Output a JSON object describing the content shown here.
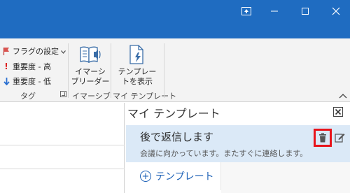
{
  "ribbon": {
    "tags_group": {
      "items": [
        {
          "label": "フラグの設定",
          "icon": "flag-icon"
        },
        {
          "label": "重要度 - 高",
          "icon": "exclamation-icon"
        },
        {
          "label": "重要度 - 低",
          "icon": "down-arrow-icon"
        }
      ],
      "group_label": "タグ"
    },
    "immersive_group": {
      "button_line1": "イマーシ",
      "button_line2": "ブリーダー",
      "group_label": "イマーシブ"
    },
    "templates_group": {
      "button_line1": "テンプレー",
      "button_line2": "トを表示",
      "group_label": "マイ テンプレート"
    }
  },
  "templates_pane": {
    "title": "マイ テンプレート",
    "items": [
      {
        "title": "後で返信します",
        "body": "会議に向かっています。またすぐに連絡します。"
      }
    ],
    "add_label": "テンプレート"
  },
  "colors": {
    "titlebar": "#1f6cc1",
    "selected_item": "#dbe9f7",
    "highlight_box": "#e8141b",
    "link": "#1e62b7"
  }
}
